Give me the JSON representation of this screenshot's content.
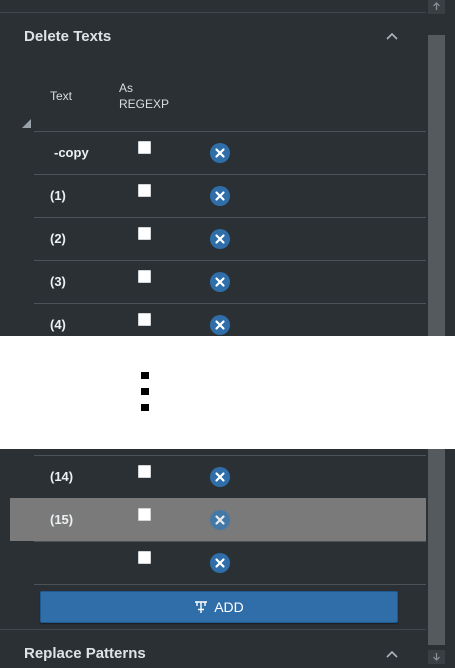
{
  "delete_section": {
    "title": "Delete Texts",
    "columns": {
      "text": "Text",
      "regexp_line1": "As",
      "regexp_line2": "REGEXP"
    },
    "rows_top": [
      {
        "text": "-copy",
        "regexp": false
      },
      {
        "text": "(1)",
        "regexp": false
      },
      {
        "text": "(2)",
        "regexp": false
      },
      {
        "text": "(3)",
        "regexp": false
      },
      {
        "text": "(4)",
        "regexp": false
      }
    ],
    "rows_bottom": [
      {
        "text": "(14)",
        "regexp": false
      },
      {
        "text": "(15)",
        "regexp": false,
        "selected": true
      },
      {
        "text": "",
        "regexp": false
      }
    ],
    "add_label": "ADD"
  },
  "replace_section": {
    "title": "Replace Patterns"
  },
  "colors": {
    "background": "#2b3035",
    "accent": "#2f6ea8",
    "selected_row": "#7a7a7a",
    "text": "#ecf0f2"
  },
  "icons": {
    "collapse": "chevron-up-icon",
    "remove": "remove-circle-icon",
    "add": "add-row-icon",
    "scroll_up": "arrow-up-icon",
    "scroll_down": "arrow-down-icon"
  }
}
